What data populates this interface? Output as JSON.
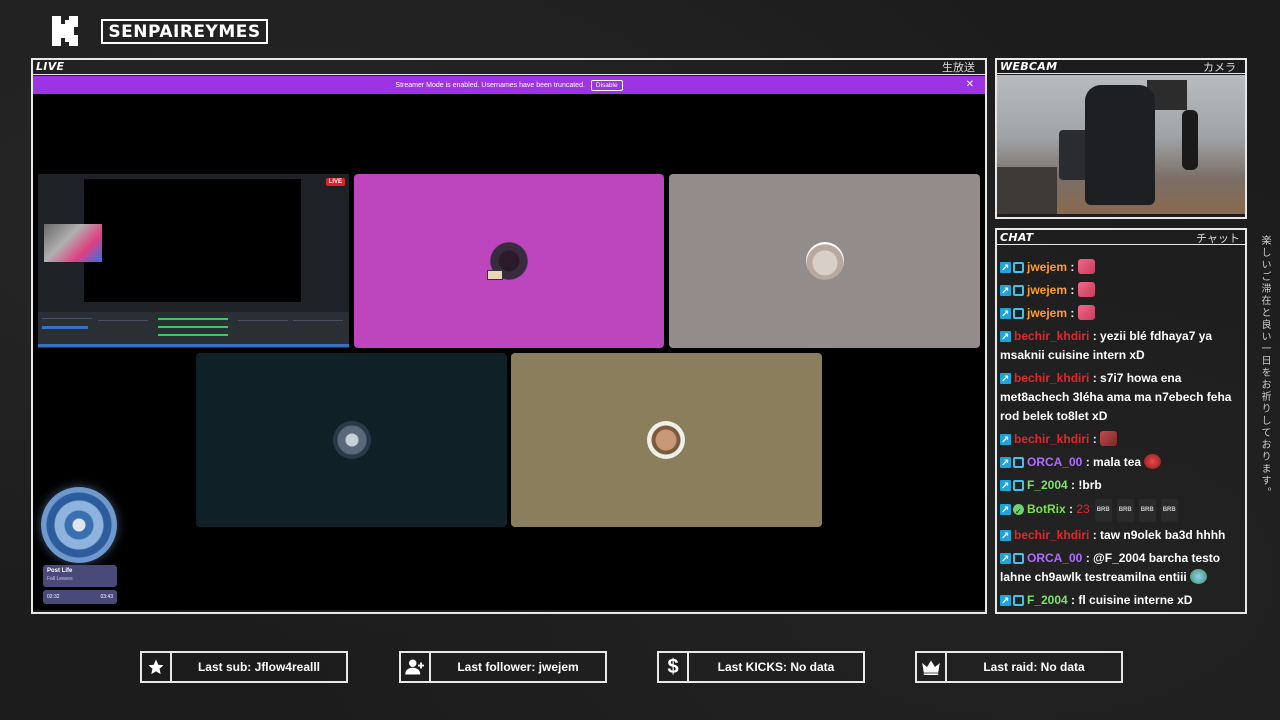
{
  "header": {
    "channel_name": "SENPAIREYMES"
  },
  "live_panel": {
    "label": "LIVE",
    "jp": "生放送"
  },
  "banner": {
    "text": "Streamer Mode is enabled. Usernames have been truncated.",
    "button": "Disable",
    "close": "✕"
  },
  "obs": {
    "live_badge": "LIVE"
  },
  "tiles": [
    {
      "name": "tile-1",
      "color": "#bd45bd"
    },
    {
      "name": "tile-2",
      "color": "#948b8b"
    },
    {
      "name": "tile-3",
      "color": "#0f2126"
    },
    {
      "name": "tile-4",
      "color": "#8a7e5c"
    }
  ],
  "music": {
    "title": "Post Life",
    "artist": "Fall Leaves",
    "time_start": "02:32",
    "time_end": "03:43"
  },
  "webcam_panel": {
    "label": "WEBCAM",
    "jp": "カメラ"
  },
  "chat_panel": {
    "label": "CHAT",
    "jp": "チャット"
  },
  "chat": [
    {
      "user": "jwejem",
      "color": "u-orange",
      "text": "",
      "emote": "sticker"
    },
    {
      "user": "jwejem",
      "color": "u-orange",
      "text": "",
      "emote": "sticker"
    },
    {
      "user": "jwejem",
      "color": "u-orange",
      "text": "",
      "emote": "sticker"
    },
    {
      "user": "bechir_khdiri",
      "color": "u-red",
      "text": "yezii blé fdhaya7 ya msaknii cuisine intern xD"
    },
    {
      "user": "bechir_khdiri",
      "color": "u-red",
      "text": "s7i7 howa ena met8achech 3léha ama ma n7ebech feha rod belek to8let xD"
    },
    {
      "user": "bechir_khdiri",
      "color": "u-red",
      "text": "",
      "emote": "mask"
    },
    {
      "user": "ORCA_00",
      "color": "u-purple",
      "text": "mala tea",
      "emote": "face"
    },
    {
      "user": "F_2004",
      "color": "u-green",
      "text": "!brb"
    },
    {
      "user": "BotRix",
      "color": "u-lime",
      "text": "",
      "bot": true,
      "extra": "23",
      "brb": [
        "BRB",
        "BRB",
        "BRB",
        "BRB"
      ]
    },
    {
      "user": "bechir_khdiri",
      "color": "u-red",
      "text": "taw n9olek ba3d hhhh"
    },
    {
      "user": "ORCA_00",
      "color": "u-purple",
      "text": "@F_2004 barcha testo lahne ch9awlk testreamilna entiii",
      "emote": "world"
    },
    {
      "user": "F_2004",
      "color": "u-green",
      "text": "fl cuisine interne xD"
    }
  ],
  "side_jp": "楽しいご滞在と良い一日をお祈りしております。",
  "stats": {
    "sub": "Last sub: Jflow4realll",
    "follower": "Last follower: jwejem",
    "kicks": "Last KICKS: No data",
    "raid": "Last raid: No data"
  },
  "icons": {
    "sub": "star-icon",
    "follower": "user-plus-icon",
    "kicks": "dollar-icon",
    "raid": "crown-icon"
  }
}
